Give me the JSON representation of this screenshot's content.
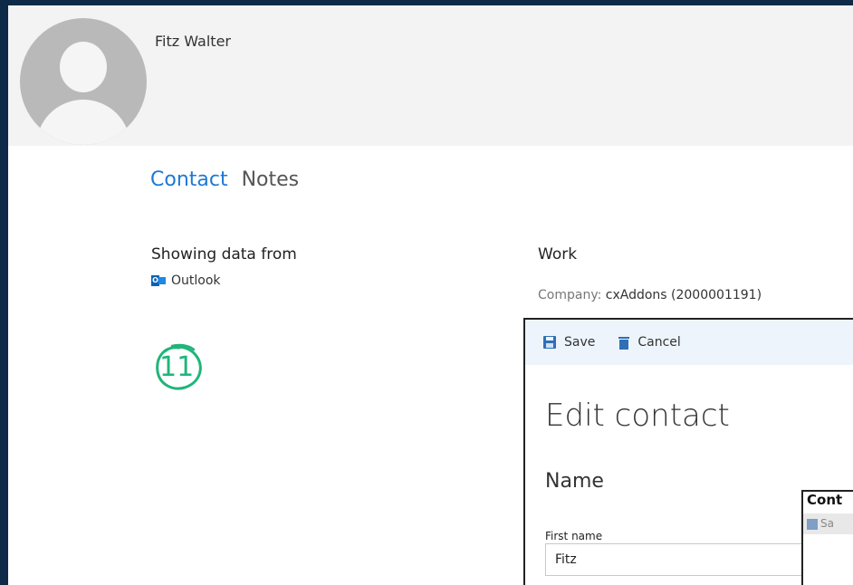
{
  "person": {
    "name": "Fitz Walter"
  },
  "tabs": [
    {
      "label": "Contact",
      "active": true
    },
    {
      "label": "Notes",
      "active": false
    }
  ],
  "source": {
    "title": "Showing data from",
    "app": "Outlook"
  },
  "annotation": {
    "number": "11"
  },
  "work": {
    "title": "Work",
    "company_label": "Company:",
    "company_value": "cxAddons (2000001191)"
  },
  "edit_contact": {
    "toolbar": {
      "save_label": "Save",
      "cancel_label": "Cancel"
    },
    "heading": "Edit contact",
    "section_name": "Name",
    "first_name_label": "First name",
    "first_name_value": "Fitz"
  },
  "overlay_dialog": {
    "title": "Cont",
    "save_label": "Sa"
  },
  "colors": {
    "accent": "#1e78d3",
    "frame": "#0d2a48",
    "annotation": "#1fb57a"
  }
}
